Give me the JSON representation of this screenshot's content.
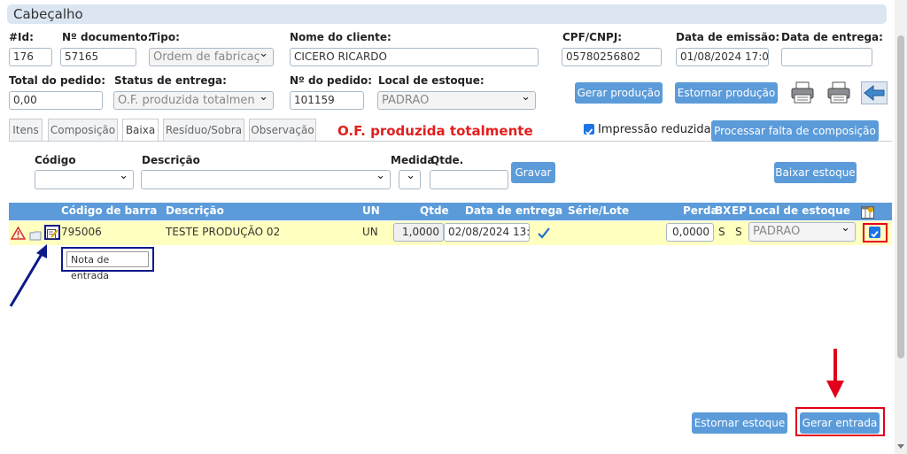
{
  "header": {
    "title": "Cabeçalho"
  },
  "form": {
    "id_label": "#Id:",
    "id_value": "176",
    "doc_label": "Nº documento:",
    "doc_value": "57165",
    "tipo_label": "Tipo:",
    "tipo_value": "Ordem de fabricaç",
    "cliente_label": "Nome do cliente:",
    "cliente_value": "CICERO RICARDO",
    "cpf_label": "CPF/CNPJ:",
    "cpf_value": "05780256802",
    "emissao_label": "Data de emissão:",
    "emissao_value": "01/08/2024 17:0",
    "entrega_label": "Data de entrega:",
    "entrega_value": "",
    "total_label": "Total do pedido:",
    "total_value": "0,00",
    "status_label": "Status de entrega:",
    "status_value": "O.F. produzida totalmen",
    "pedido_label": "Nº do pedido:",
    "pedido_value": "101159",
    "local_label": "Local de estoque:",
    "local_value": "PADRAO"
  },
  "actions": {
    "gerar_producao": "Gerar produção",
    "estornar_producao": "Estornar produção"
  },
  "tabs": [
    {
      "label": "Itens"
    },
    {
      "label": "Composição"
    },
    {
      "label": "Baixa"
    },
    {
      "label": "Resíduo/Sobra"
    },
    {
      "label": "Observação"
    }
  ],
  "status_banner": "O.F. produzida totalmente",
  "impressao_label": "Impressão reduzida",
  "processar_falta": "Processar falta de composição",
  "filters": {
    "codigo_label": "Código",
    "descricao_label": "Descrição",
    "medida_label": "Medida",
    "qtde_label": "Qtde.",
    "gravar": "Gravar",
    "baixar_estoque": "Baixar estoque"
  },
  "table": {
    "headers": {
      "codigo_barra": "Código de barra",
      "descricao": "Descrição",
      "un": "UN",
      "qtde": "Qtde",
      "data_entrega": "Data de entrega",
      "serie_lote": "Série/Lote",
      "perda": "Perda",
      "bx": "BX",
      "ep": "EP",
      "local": "Local de estoque"
    },
    "rows": [
      {
        "codigo": "795006",
        "descricao": "TESTE PRODUÇÃO 02",
        "un": "UN",
        "qtde": "1,0000",
        "data_entrega": "02/08/2024 13:",
        "perda": "0,0000",
        "bx": "S",
        "ep": "S",
        "local": "PADRAO"
      }
    ]
  },
  "tooltip": "Nota de entrada",
  "footer": {
    "estornar_estoque": "Estornar estoque",
    "gerar_entrada": "Gerar entrada"
  },
  "colors": {
    "accent": "#5b9bd9",
    "table_header": "#5b9bd9",
    "row_highlight": "#ffffbf",
    "status_red": "#e0201f",
    "annotation_red": "#e3001b",
    "annotation_blue": "#0e1a8a"
  }
}
